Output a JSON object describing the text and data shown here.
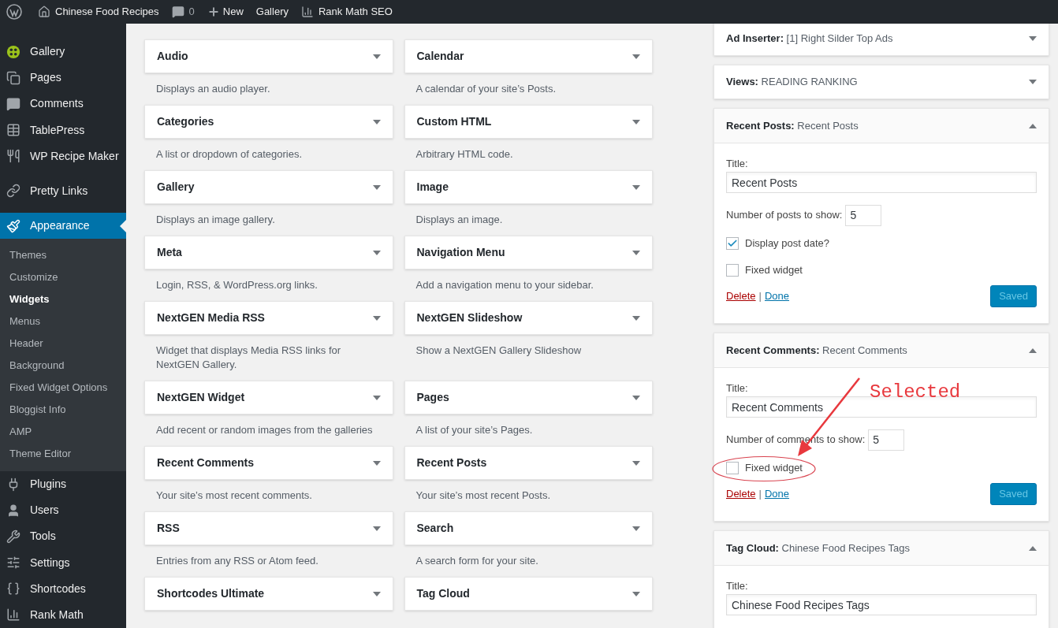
{
  "top_bar": {
    "site_name": "Chinese Food Recipes",
    "comments_count": "0",
    "new_label": "New",
    "gallery_label": "Gallery",
    "seo_label": "Rank Math SEO"
  },
  "admin_menu": {
    "items": [
      {
        "label": "Gallery",
        "selected": false
      },
      {
        "label": "Pages",
        "selected": false
      },
      {
        "label": "Comments",
        "selected": false
      },
      {
        "label": "TablePress",
        "selected": false
      },
      {
        "label": "WP Recipe Maker",
        "selected": false
      },
      {
        "label": "Pretty Links",
        "selected": false
      },
      {
        "label": "Appearance",
        "selected": true,
        "children": [
          {
            "label": "Themes",
            "selected": false
          },
          {
            "label": "Customize",
            "selected": false
          },
          {
            "label": "Widgets",
            "selected": true
          },
          {
            "label": "Menus",
            "selected": false
          },
          {
            "label": "Header",
            "selected": false
          },
          {
            "label": "Background",
            "selected": false
          },
          {
            "label": "Fixed Widget Options",
            "selected": false
          },
          {
            "label": "Bloggist Info",
            "selected": false
          },
          {
            "label": "AMP",
            "selected": false
          },
          {
            "label": "Theme Editor",
            "selected": false
          }
        ]
      },
      {
        "label": "Plugins",
        "selected": false
      },
      {
        "label": "Users",
        "selected": false
      },
      {
        "label": "Tools",
        "selected": false
      },
      {
        "label": "Settings",
        "selected": false
      },
      {
        "label": "Shortcodes",
        "selected": false
      },
      {
        "label": "Rank Math",
        "selected": false
      }
    ]
  },
  "available_widgets": {
    "items": [
      {
        "title": "Audio",
        "description": "Displays an audio player."
      },
      {
        "title": "Calendar",
        "description": "A calendar of your site’s Posts."
      },
      {
        "title": "Categories",
        "description": "A list or dropdown of categories."
      },
      {
        "title": "Custom HTML",
        "description": "Arbitrary HTML code."
      },
      {
        "title": "Gallery",
        "description": "Displays an image gallery."
      },
      {
        "title": "Image",
        "description": "Displays an image."
      },
      {
        "title": "Meta",
        "description": "Login, RSS, & WordPress.org links."
      },
      {
        "title": "Navigation Menu",
        "description": "Add a navigation menu to your sidebar."
      },
      {
        "title": "NextGEN Media RSS",
        "description": "Widget that displays Media RSS links for NextGEN Gallery."
      },
      {
        "title": "NextGEN Slideshow",
        "description": "Show a NextGEN Gallery Slideshow"
      },
      {
        "title": "NextGEN Widget",
        "description": "Add recent or random images from the galleries"
      },
      {
        "title": "Pages",
        "description": "A list of your site’s Pages."
      },
      {
        "title": "Recent Comments",
        "description": "Your site’s most recent comments."
      },
      {
        "title": "Recent Posts",
        "description": "Your site’s most recent Posts."
      },
      {
        "title": "RSS",
        "description": "Entries from any RSS or Atom feed."
      },
      {
        "title": "Search",
        "description": "A search form for your site."
      },
      {
        "title": "Shortcodes Ultimate"
      },
      {
        "title": "Tag Cloud"
      }
    ]
  },
  "sidebar_widgets": [
    {
      "type": "Ad Inserter:",
      "title": "[1] Right Silder Top Ads",
      "expanded": false
    },
    {
      "type": "Views:",
      "title": "READING RANKING",
      "expanded": false
    },
    {
      "type": "Recent Posts:",
      "title": "Recent Posts",
      "expanded": true,
      "fields": [
        {
          "kind": "text",
          "label": "Title:",
          "value": "Recent Posts"
        },
        {
          "kind": "number",
          "label": "Number of posts to show:",
          "value": "5"
        },
        {
          "kind": "checkbox",
          "label": "Display post date?",
          "checked": true
        },
        {
          "kind": "checkbox",
          "label": "Fixed widget",
          "checked": false
        }
      ],
      "delete_label": "Delete",
      "separator": "|",
      "done_label": "Done",
      "save_label": "Saved"
    },
    {
      "type": "Recent Comments:",
      "title": "Recent Comments",
      "expanded": true,
      "fields": [
        {
          "kind": "text",
          "label": "Title:",
          "value": "Recent Comments"
        },
        {
          "kind": "number",
          "label": "Number of comments to show:",
          "value": "5"
        },
        {
          "kind": "checkbox",
          "label": "Fixed widget",
          "checked": false
        }
      ],
      "delete_label": "Delete",
      "separator": "|",
      "done_label": "Done",
      "save_label": "Saved"
    },
    {
      "type": "Tag Cloud:",
      "title": "Chinese Food Recipes Tags",
      "expanded": true,
      "fields": [
        {
          "kind": "text",
          "label": "Title:",
          "value": "Chinese Food Recipes Tags"
        }
      ]
    }
  ],
  "annotation": {
    "text": "Selected"
  }
}
